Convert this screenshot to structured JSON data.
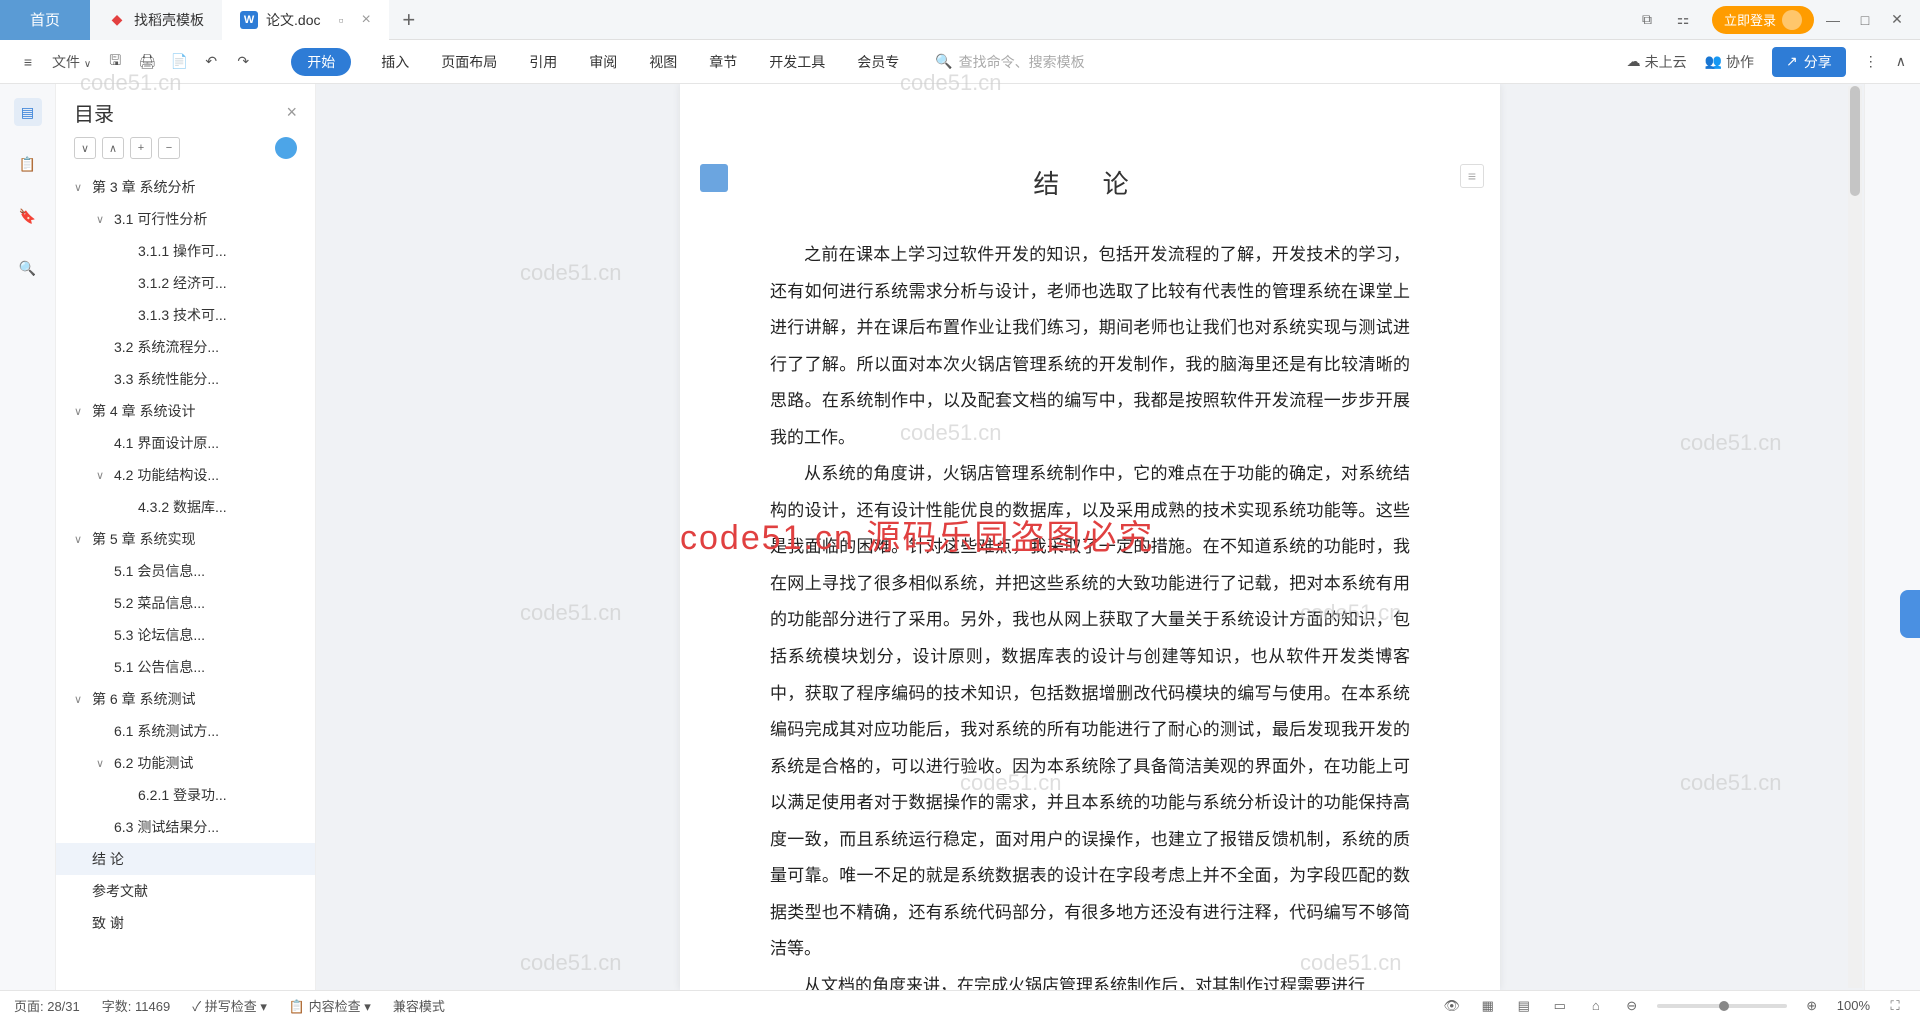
{
  "tabs": {
    "home": "首页",
    "t1": "找稻壳模板",
    "t2": "论文.doc"
  },
  "login": "立即登录",
  "file_menu": "文件",
  "menu": [
    "开始",
    "插入",
    "页面布局",
    "引用",
    "审阅",
    "视图",
    "章节",
    "开发工具",
    "会员专"
  ],
  "search_placeholder": "查找命令、搜索模板",
  "cloud": "未上云",
  "collab": "协作",
  "share": "分享",
  "outline": {
    "title": "目录",
    "items": [
      {
        "lvl": 1,
        "exp": "∨",
        "txt": "第 3 章  系统分析"
      },
      {
        "lvl": 2,
        "exp": "∨",
        "txt": "3.1 可行性分析"
      },
      {
        "lvl": 3,
        "exp": "",
        "txt": "3.1.1 操作可..."
      },
      {
        "lvl": 3,
        "exp": "",
        "txt": "3.1.2 经济可..."
      },
      {
        "lvl": 3,
        "exp": "",
        "txt": "3.1.3 技术可..."
      },
      {
        "lvl": 2,
        "exp": "",
        "txt": "3.2 系统流程分..."
      },
      {
        "lvl": 2,
        "exp": "",
        "txt": "3.3 系统性能分..."
      },
      {
        "lvl": 1,
        "exp": "∨",
        "txt": "第 4 章  系统设计"
      },
      {
        "lvl": 2,
        "exp": "",
        "txt": "4.1 界面设计原..."
      },
      {
        "lvl": 2,
        "exp": "∨",
        "txt": "4.2 功能结构设..."
      },
      {
        "lvl": 3,
        "exp": "",
        "txt": "4.3.2 数据库..."
      },
      {
        "lvl": 1,
        "exp": "∨",
        "txt": "第 5 章  系统实现"
      },
      {
        "lvl": 2,
        "exp": "",
        "txt": "5.1 会员信息..."
      },
      {
        "lvl": 2,
        "exp": "",
        "txt": "5.2 菜品信息..."
      },
      {
        "lvl": 2,
        "exp": "",
        "txt": "5.3 论坛信息..."
      },
      {
        "lvl": 2,
        "exp": "",
        "txt": "5.1 公告信息..."
      },
      {
        "lvl": 1,
        "exp": "∨",
        "txt": "第 6 章  系统测试"
      },
      {
        "lvl": 2,
        "exp": "",
        "txt": "6.1  系统测试方..."
      },
      {
        "lvl": 2,
        "exp": "∨",
        "txt": "6.2 功能测试"
      },
      {
        "lvl": 3,
        "exp": "",
        "txt": "6.2.1 登录功..."
      },
      {
        "lvl": 2,
        "exp": "",
        "txt": "6.3 测试结果分..."
      },
      {
        "lvl": 0,
        "exp": "",
        "txt": "结   论",
        "sel": true
      },
      {
        "lvl": 0,
        "exp": "",
        "txt": "参考文献"
      },
      {
        "lvl": 0,
        "exp": "",
        "txt": "致   谢"
      }
    ]
  },
  "doc": {
    "title": "结   论",
    "p1": "之前在课本上学习过软件开发的知识，包括开发流程的了解，开发技术的学习，还有如何进行系统需求分析与设计，老师也选取了比较有代表性的管理系统在课堂上进行讲解，并在课后布置作业让我们练习，期间老师也让我们也对系统实现与测试进行了了解。所以面对本次火锅店管理系统的开发制作，我的脑海里还是有比较清晰的思路。在系统制作中，以及配套文档的编写中，我都是按照软件开发流程一步步开展我的工作。",
    "p2": "从系统的角度讲，火锅店管理系统制作中，它的难点在于功能的确定，对系统结构的设计，还有设计性能优良的数据库，以及采用成熟的技术实现系统功能等。这些是我面临的困难。针对这些难点，我采取了一定的措施。在不知道系统的功能时，我在网上寻找了很多相似系统，并把这些系统的大致功能进行了记载，把对本系统有用的功能部分进行了采用。另外，我也从网上获取了大量关于系统设计方面的知识，包括系统模块划分，设计原则，数据库表的设计与创建等知识，也从软件开发类博客中，获取了程序编码的技术知识，包括数据增删改代码模块的编写与使用。在本系统编码完成其对应功能后，我对系统的所有功能进行了耐心的测试，最后发现我开发的系统是合格的，可以进行验收。因为本系统除了具备简洁美观的界面外，在功能上可以满足使用者对于数据操作的需求，并且本系统的功能与系统分析设计的功能保持高度一致，而且系统运行稳定，面对用户的误操作，也建立了报错反馈机制，系统的质量可靠。唯一不足的就是系统数据表的设计在字段考虑上并不全面，为字段匹配的数据类型也不精确，还有系统代码部分，有很多地方还没有进行注释，代码编写不够简洁等。",
    "p3": "从文档的角度来讲，在完成火锅店管理系统制作后，对其制作过程需要进行"
  },
  "watermark_small": "code51.cn",
  "watermark_big": "code51.cn  源码乐园盗图必究",
  "status": {
    "page": "页面: 28/31",
    "words": "字数: 11469",
    "spell": "拼写检查",
    "content": "内容检查",
    "compat": "兼容模式",
    "zoom": "100%"
  }
}
